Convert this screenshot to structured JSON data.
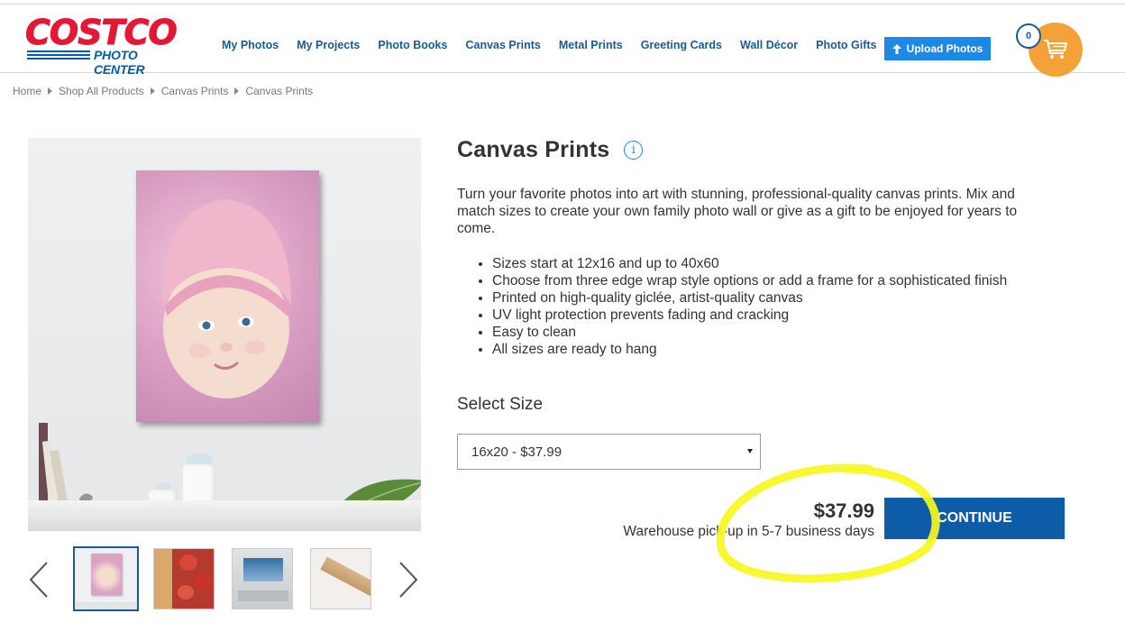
{
  "logo": {
    "brand": "COSTCO",
    "sub": "PHOTO CENTER"
  },
  "nav": [
    {
      "label": "My Photos"
    },
    {
      "label": "My Projects"
    },
    {
      "label": "Photo Books"
    },
    {
      "label": "Canvas Prints"
    },
    {
      "label": "Metal Prints"
    },
    {
      "label": "Greeting Cards"
    },
    {
      "label": "Wall Décor"
    },
    {
      "label": "Photo Gifts"
    }
  ],
  "upload": {
    "label": "Upload Photos",
    "icon": "upload-arrow-icon"
  },
  "cart": {
    "count": "0",
    "icon": "shopping-cart-icon"
  },
  "breadcrumb": [
    "Home",
    "Shop All Products",
    "Canvas Prints",
    "Canvas Prints"
  ],
  "product": {
    "title": "Canvas Prints",
    "info_icon": "ⓘ",
    "description": "Turn your favorite photos into art with stunning, professional-quality canvas prints. Mix and match sizes to create your own family photo wall or give as a gift to be enjoyed for years to come.",
    "features": [
      "Sizes start at 12x16 and up to 40x60",
      "Choose from three edge wrap style options or add a frame for a sophisticated finish",
      "Printed on high-quality giclée, artist-quality canvas",
      "UV light protection prevents fading and cracking",
      "Easy to clean",
      "All sizes are ready to hang"
    ]
  },
  "size": {
    "label": "Select Size",
    "selected": "16x20 - $37.99"
  },
  "purchase": {
    "price": "$37.99",
    "pickup": "Warehouse pick-up in 5-7 business days",
    "continue_label": "CONTINUE"
  },
  "colors": {
    "brand_red": "#e31837",
    "brand_blue": "#005daa",
    "nav_link": "#1a5a96",
    "upload_button": "#1e88e5",
    "continue_button": "#0d5ca8",
    "cart_orange": "#f5a13a",
    "highlight_yellow": "#f7f71e"
  }
}
